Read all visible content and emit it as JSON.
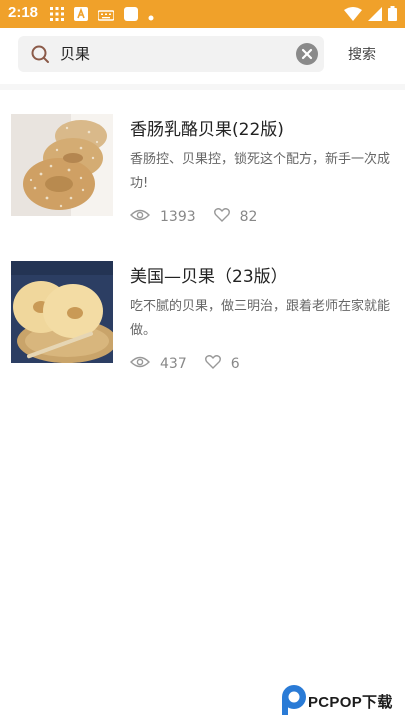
{
  "status_bar": {
    "time": "2:18",
    "background": "#f0a12a"
  },
  "search": {
    "query": "贝果",
    "button_label": "搜索"
  },
  "recipes": [
    {
      "title": "香肠乳酪贝果(22版)",
      "description": "香肠控、贝果控，锁死这个配方，新手一次成功!",
      "views": "1393",
      "likes": "82"
    },
    {
      "title": "美国—贝果（23版）",
      "description": "吃不腻的贝果，做三明治，跟着老师在家就能做。",
      "views": "437",
      "likes": "6"
    }
  ],
  "watermark": {
    "text": "PCPOP下载"
  }
}
